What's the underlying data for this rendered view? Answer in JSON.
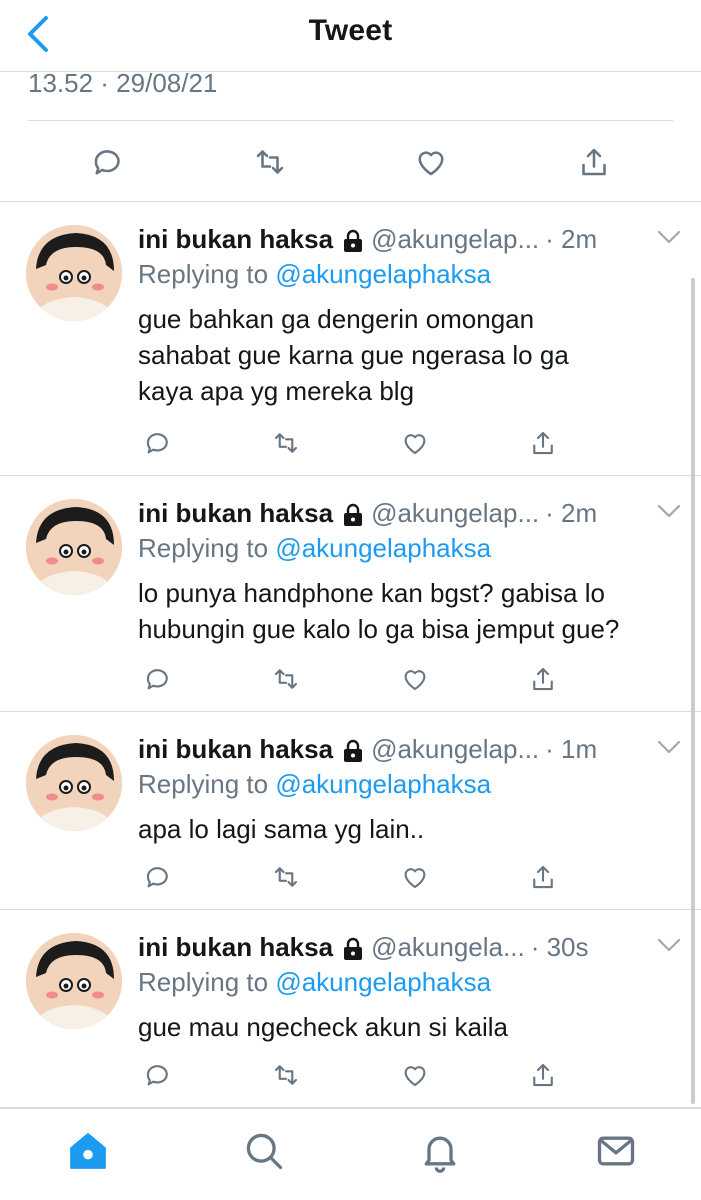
{
  "header": {
    "title": "Tweet",
    "back_icon": "chevron-left-icon"
  },
  "tweet": {
    "timestamp": "13.52 · 29/08/21"
  },
  "colors": {
    "accent": "#1d9bf0",
    "secondary_text": "#687684",
    "divider": "#d7dbde",
    "avatar_skin": "#f2d3bc"
  },
  "replies": [
    {
      "name": "ini bukan haksa",
      "handle": "@akungelap...",
      "time": "· 2m",
      "replying_label": "Replying to",
      "replying_to": "@akungelaphaksa",
      "lines": [
        "gue bahkan ga dengerin omongan",
        "sahabat gue karna gue ngerasa lo ga",
        "kaya apa yg mereka blg"
      ]
    },
    {
      "name": "ini bukan haksa",
      "handle": "@akungelap...",
      "time": "· 2m",
      "replying_label": "Replying to",
      "replying_to": "@akungelaphaksa",
      "lines": [
        "lo punya handphone kan bgst? gabisa lo",
        "hubungin gue kalo lo ga bisa jemput gue?"
      ]
    },
    {
      "name": "ini bukan haksa",
      "handle": "@akungelap...",
      "time": "· 1m",
      "replying_label": "Replying to",
      "replying_to": "@akungelaphaksa",
      "lines": [
        "apa lo lagi sama yg lain.."
      ]
    },
    {
      "name": "ini bukan haksa",
      "handle": "@akungela...",
      "time": "· 30s",
      "replying_label": "Replying to",
      "replying_to": "@akungelaphaksa",
      "lines": [
        "gue mau ngecheck akun si kaila"
      ]
    }
  ],
  "bottom_nav": [
    "home-icon",
    "search-icon",
    "notifications-icon",
    "messages-icon"
  ]
}
